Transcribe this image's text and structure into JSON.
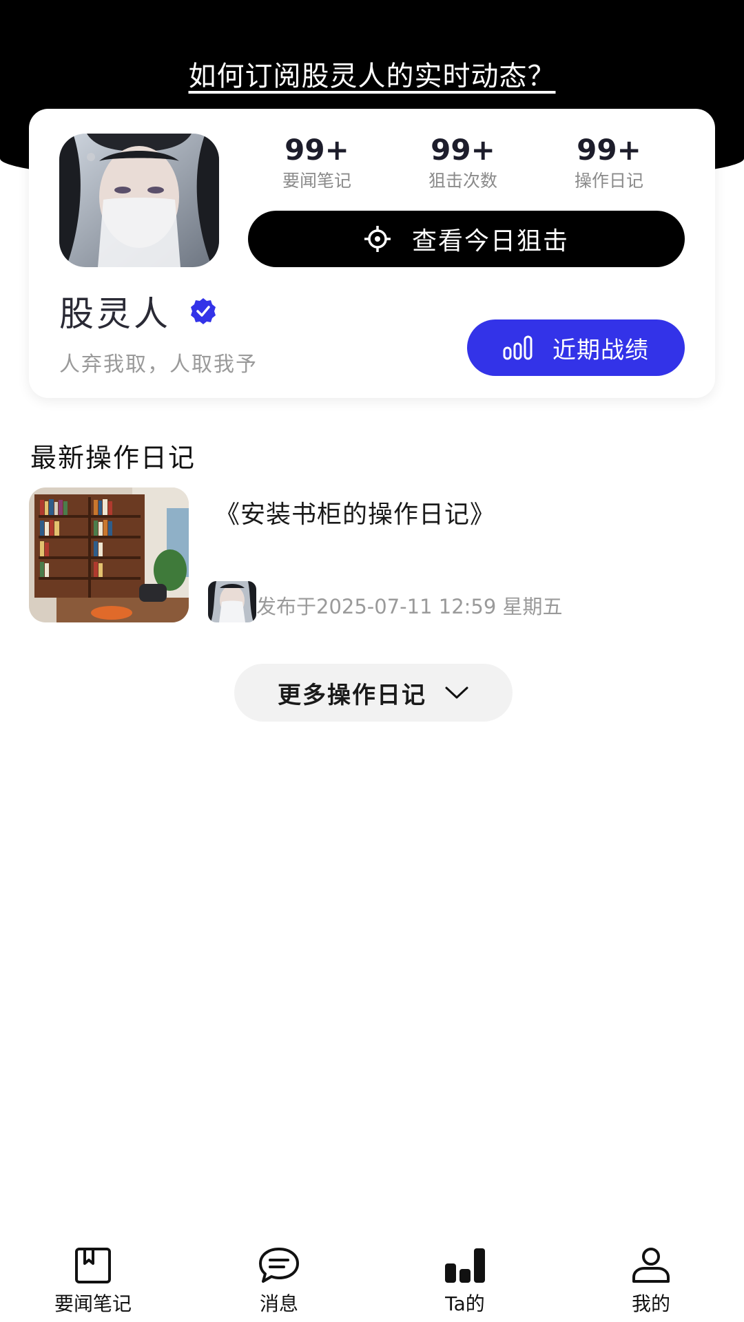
{
  "header": {
    "subscribe_link": "如何订阅股灵人的实时动态？"
  },
  "profile": {
    "name": "股灵人",
    "motto": "人弃我取，人取我予",
    "stats": [
      {
        "value": "99+",
        "label": "要闻笔记"
      },
      {
        "value": "99+",
        "label": "狙击次数"
      },
      {
        "value": "99+",
        "label": "操作日记"
      }
    ],
    "snipe_button": "查看今日狙击",
    "record_button": "近期战绩",
    "colors": {
      "accent": "#3333e8",
      "dark": "#000000"
    }
  },
  "latest": {
    "section_title": "最新操作日记",
    "items": [
      {
        "title": "《安装书柜的操作日记》",
        "published": "发布于2025-07-11 12:59 星期五",
        "thumb_icon": "bookshelf-photo",
        "author_icon": "author-avatar"
      }
    ],
    "more_button": "更多操作日记"
  },
  "tabbar": {
    "items": [
      {
        "label": "要闻笔记",
        "icon": "bookmark-book-icon"
      },
      {
        "label": "消息",
        "icon": "chat-bubble-icon"
      },
      {
        "label": "Ta的",
        "icon": "bar-chart-icon"
      },
      {
        "label": "我的",
        "icon": "person-icon"
      }
    ]
  }
}
